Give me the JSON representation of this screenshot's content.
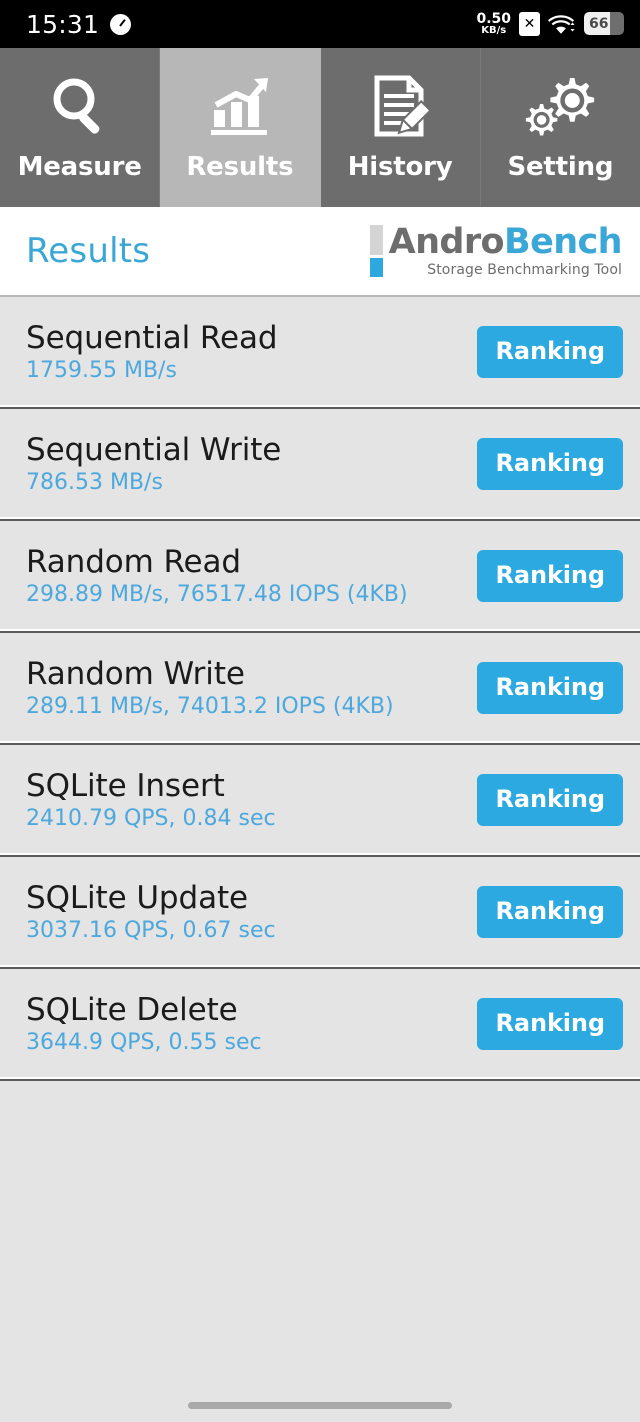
{
  "status_bar": {
    "time": "15:31",
    "clock_icon": "speedometer-icon",
    "net_speed_value": "0.50",
    "net_speed_unit": "KB/s",
    "sim_icon_label": "✕",
    "wifi_icon": "wifi-icon",
    "battery_level": "66",
    "battery_percent": 66
  },
  "tabs": [
    {
      "label": "Measure",
      "icon": "magnifier-icon",
      "active": false
    },
    {
      "label": "Results",
      "icon": "bar-chart-arrow-icon",
      "active": true
    },
    {
      "label": "History",
      "icon": "document-pencil-icon",
      "active": false
    },
    {
      "label": "Setting",
      "icon": "gears-icon",
      "active": false
    }
  ],
  "header": {
    "title": "Results",
    "logo_andro": "Andro",
    "logo_bench": "Bench",
    "logo_tagline": "Storage Benchmarking Tool"
  },
  "colors": {
    "accent_blue": "#2ba9e0",
    "title_blue": "#3ba7d6",
    "value_blue": "#4da8dd",
    "tab_bg": "#6d6d6d",
    "tab_active_bg": "#b7b7b7",
    "list_bg": "#e4e4e4",
    "logo_gray": "#6d6d6d"
  },
  "results": [
    {
      "name": "Sequential Read",
      "value": "1759.55 MB/s",
      "button": "Ranking"
    },
    {
      "name": "Sequential Write",
      "value": "786.53 MB/s",
      "button": "Ranking"
    },
    {
      "name": "Random Read",
      "value": "298.89 MB/s, 76517.48 IOPS (4KB)",
      "button": "Ranking"
    },
    {
      "name": "Random Write",
      "value": "289.11 MB/s, 74013.2 IOPS (4KB)",
      "button": "Ranking"
    },
    {
      "name": "SQLite Insert",
      "value": "2410.79 QPS, 0.84 sec",
      "button": "Ranking"
    },
    {
      "name": "SQLite Update",
      "value": "3037.16 QPS, 0.67 sec",
      "button": "Ranking"
    },
    {
      "name": "SQLite Delete",
      "value": "3644.9 QPS, 0.55 sec",
      "button": "Ranking"
    }
  ]
}
